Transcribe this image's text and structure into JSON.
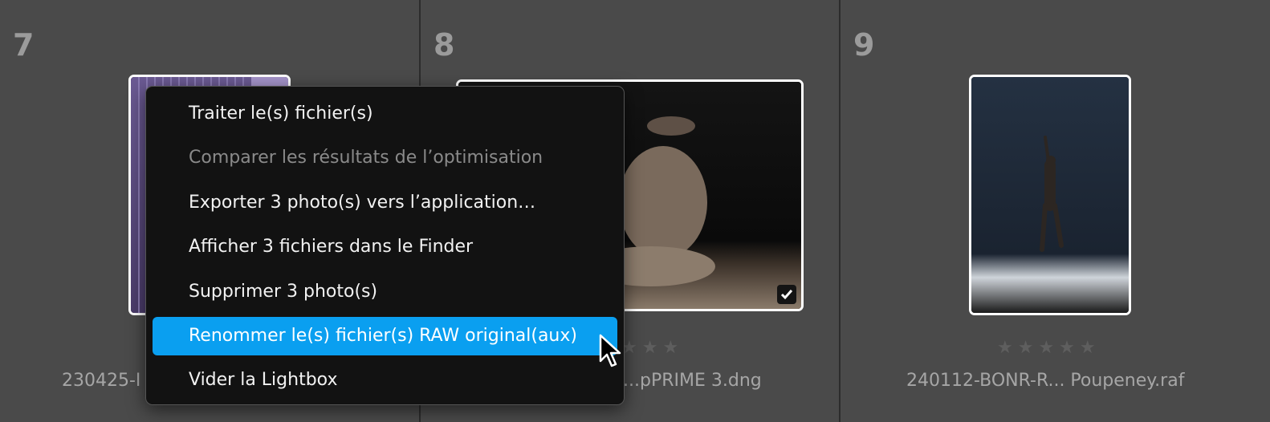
{
  "cells": [
    {
      "number": "7",
      "filename": "230425-I",
      "stars": "★★★★★"
    },
    {
      "number": "8",
      "filename": "...pPRIME 3.dng",
      "stars": "★★★"
    },
    {
      "number": "9",
      "filename": "240112-BONR-R... Poupeney.raf",
      "stars": "★★★★★"
    }
  ],
  "context_menu": {
    "items": [
      {
        "label": "Traiter le(s) fichier(s)",
        "state": "enabled"
      },
      {
        "label": "Comparer les résultats de l’optimisation",
        "state": "disabled"
      },
      {
        "label": "Exporter 3 photo(s) vers l’application…",
        "state": "enabled"
      },
      {
        "label": "Afficher 3 fichiers dans le Finder",
        "state": "enabled"
      },
      {
        "label": "Supprimer 3 photo(s)",
        "state": "enabled"
      },
      {
        "label": "Renommer le(s) fichier(s) RAW original(aux)",
        "state": "highlighted"
      },
      {
        "label": "Vider la Lightbox",
        "state": "enabled"
      }
    ]
  },
  "colors": {
    "background": "#4a4a4a",
    "menu_background": "#121212",
    "highlight": "#0a9ff0"
  }
}
